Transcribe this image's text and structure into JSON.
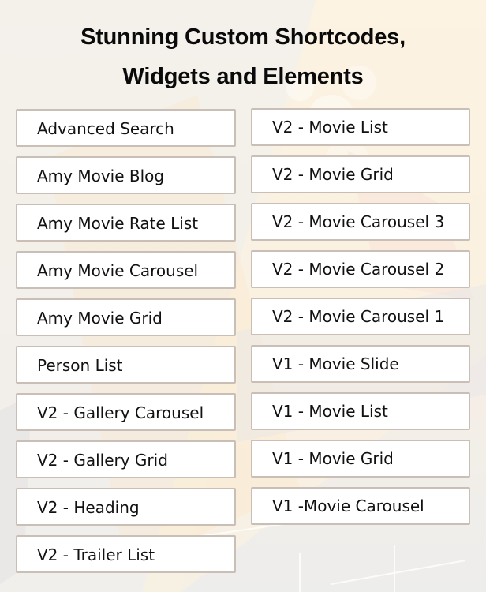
{
  "heading": {
    "line1": "Stunning Custom Shortcodes,",
    "line2": "Widgets and Elements"
  },
  "left_column": [
    {
      "label": "Advanced Search"
    },
    {
      "label": "Amy Movie Blog"
    },
    {
      "label": "Amy Movie Rate List"
    },
    {
      "label": "Amy Movie Carousel"
    },
    {
      "label": "Amy Movie Grid"
    },
    {
      "label": "Person List"
    },
    {
      "label": "V2 - Gallery Carousel"
    },
    {
      "label": "V2 - Gallery Grid"
    },
    {
      "label": "V2 - Heading"
    },
    {
      "label": "V2 - Trailer List"
    }
  ],
  "right_column": [
    {
      "label": "V2 - Movie List"
    },
    {
      "label": "V2 - Movie Grid"
    },
    {
      "label": "V2 - Movie Carousel 3"
    },
    {
      "label": "V2 - Movie Carousel 2"
    },
    {
      "label": "V2 - Movie Carousel 1"
    },
    {
      "label": "V1 - Movie Slide"
    },
    {
      "label": "V1 - Movie List"
    },
    {
      "label": "V1 - Movie Grid"
    },
    {
      "label": "V1 -Movie Carousel"
    }
  ],
  "colors": {
    "box_border": "#c9bfb6",
    "box_fill": "#ffffff",
    "title_text": "#0a0a0a",
    "bg_warm": "#fdf0da",
    "bg_cool": "#ececec"
  }
}
